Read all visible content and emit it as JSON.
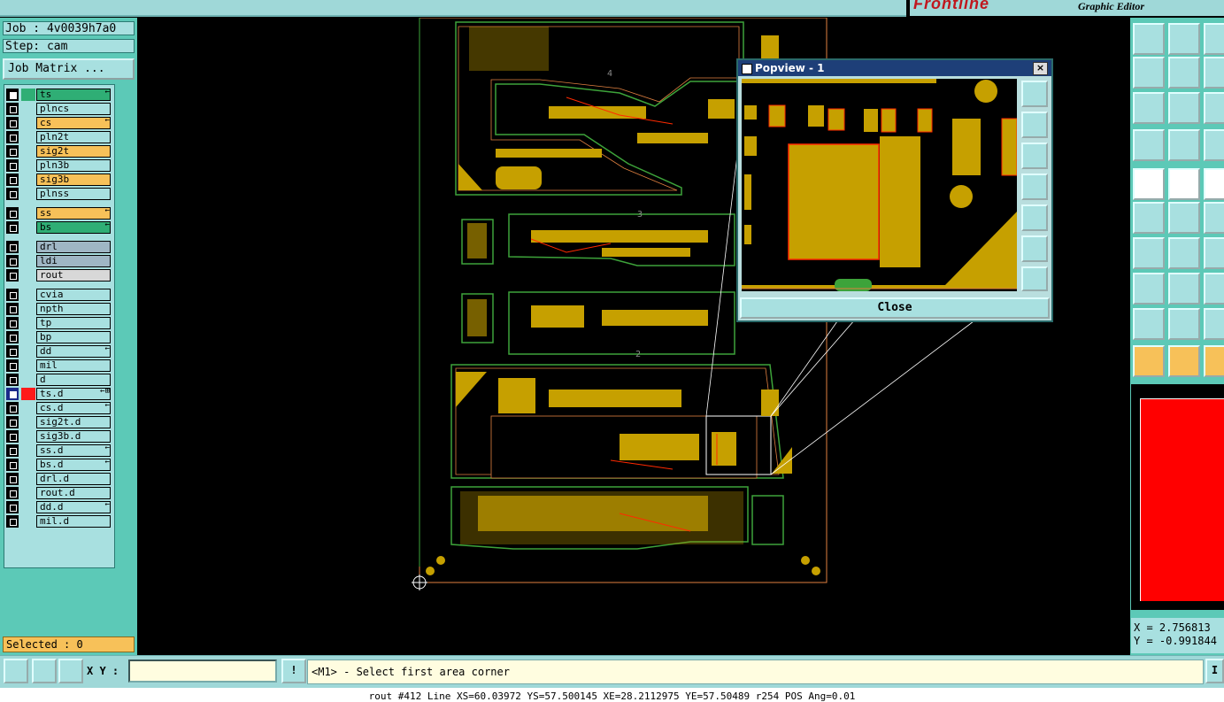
{
  "header": {
    "brand_logo": "Frontline",
    "brand_subtitle": "Graphic Editor"
  },
  "left_panel": {
    "job_label": "Job : 4v0039h7a0",
    "step_label": "Step: cam",
    "job_matrix_button": "Job Matrix ...",
    "layers": [
      {
        "name": "ts",
        "color": "#2fae75",
        "checked": true,
        "flag": "←",
        "swatch": "#2fae75"
      },
      {
        "name": "plncs",
        "color": "#a8e0e0",
        "checked": false,
        "flag": ""
      },
      {
        "name": "cs",
        "color": "#f7c159",
        "checked": false,
        "flag": "←"
      },
      {
        "name": "pln2t",
        "color": "#a8e0e0",
        "checked": false,
        "flag": ""
      },
      {
        "name": "sig2t",
        "color": "#f7c159",
        "checked": false,
        "flag": ""
      },
      {
        "name": "pln3b",
        "color": "#a8e0e0",
        "checked": false,
        "flag": ""
      },
      {
        "name": "sig3b",
        "color": "#f7c159",
        "checked": false,
        "flag": ""
      },
      {
        "name": "plnss",
        "color": "#a8e0e0",
        "checked": false,
        "flag": ""
      },
      {
        "name": "ss",
        "color": "#f7c159",
        "checked": false,
        "flag": "←"
      },
      {
        "name": "bs",
        "color": "#2fae75",
        "checked": false,
        "flag": "←"
      },
      {
        "name": "drl",
        "color": "#9fb6c4",
        "checked": false,
        "flag": ""
      },
      {
        "name": "ldi",
        "color": "#9fb6c4",
        "checked": false,
        "flag": ""
      },
      {
        "name": "rout",
        "color": "#d8d8d8",
        "checked": false,
        "flag": ""
      },
      {
        "name": "cvia",
        "color": "#a8e0e0",
        "checked": false,
        "flag": ""
      },
      {
        "name": "npth",
        "color": "#a8e0e0",
        "checked": false,
        "flag": ""
      },
      {
        "name": "tp",
        "color": "#a8e0e0",
        "checked": false,
        "flag": ""
      },
      {
        "name": "bp",
        "color": "#a8e0e0",
        "checked": false,
        "flag": ""
      },
      {
        "name": "dd",
        "color": "#a8e0e0",
        "checked": false,
        "flag": "←"
      },
      {
        "name": "mil",
        "color": "#a8e0e0",
        "checked": false,
        "flag": ""
      },
      {
        "name": "d",
        "color": "#a8e0e0",
        "checked": false,
        "flag": ""
      },
      {
        "name": "ts.d",
        "color": "#a8e0e0",
        "checked": true,
        "flag": "←⊞",
        "swatch": "#ff1a1a",
        "active": true
      },
      {
        "name": "cs.d",
        "color": "#a8e0e0",
        "checked": false,
        "flag": "←"
      },
      {
        "name": "sig2t.d",
        "color": "#a8e0e0",
        "checked": false,
        "flag": ""
      },
      {
        "name": "sig3b.d",
        "color": "#a8e0e0",
        "checked": false,
        "flag": ""
      },
      {
        "name": "ss.d",
        "color": "#a8e0e0",
        "checked": false,
        "flag": "←"
      },
      {
        "name": "bs.d",
        "color": "#a8e0e0",
        "checked": false,
        "flag": "←"
      },
      {
        "name": "drl.d",
        "color": "#a8e0e0",
        "checked": false,
        "flag": ""
      },
      {
        "name": "rout.d",
        "color": "#a8e0e0",
        "checked": false,
        "flag": ""
      },
      {
        "name": "dd.d",
        "color": "#a8e0e0",
        "checked": false,
        "flag": "←"
      },
      {
        "name": "mil.d",
        "color": "#a8e0e0",
        "checked": false,
        "flag": ""
      }
    ],
    "selected_label": "Selected : 0"
  },
  "popview": {
    "title": "Popview - 1",
    "close_x": "×",
    "close_button": "Close"
  },
  "right_panel": {
    "coord_x": "X = 2.756813",
    "coord_y": "Y = -0.991844"
  },
  "bottom_bar": {
    "xy_label": "X Y :",
    "xy_value": "",
    "warn_glyph": "!",
    "prompt": "<M1> - Select first area corner",
    "right_glyph": "I"
  },
  "status_line": "rout #412 Line XS=60.03972 YS=57.500145 XE=28.2112975 YE=57.50489 r254 POS Ang=0.01",
  "colors": {
    "panel_bg": "#5cc9b7",
    "field_bg": "#a8e0e0",
    "copper": "#c6a000",
    "outline_green": "#3da33a",
    "trace_red": "#ff2a00",
    "selection_orange": "#f7c159"
  }
}
